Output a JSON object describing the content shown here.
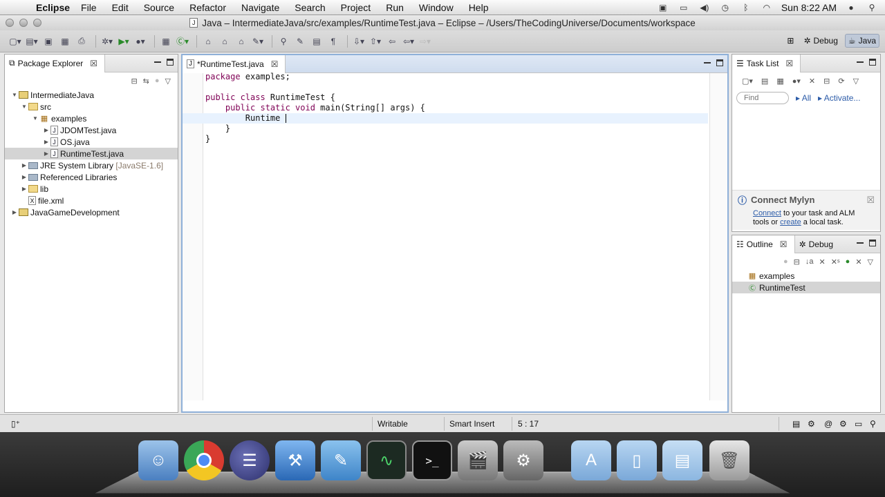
{
  "menubar": {
    "app": "Eclipse",
    "items": [
      "File",
      "Edit",
      "Source",
      "Refactor",
      "Navigate",
      "Search",
      "Project",
      "Run",
      "Window",
      "Help"
    ],
    "clock": "Sun 8:22 AM"
  },
  "window": {
    "title": "Java – IntermediateJava/src/examples/RuntimeTest.java – Eclipse – /Users/TheCodingUniverse/Documents/workspace"
  },
  "perspectives": {
    "debug": "Debug",
    "java": "Java"
  },
  "package_explorer": {
    "tab": "Package Explorer",
    "tree": [
      {
        "label": "IntermediateJava",
        "extra": ""
      },
      {
        "label": "src",
        "extra": ""
      },
      {
        "label": "examples",
        "extra": ""
      },
      {
        "label": "JDOMTest.java",
        "extra": ""
      },
      {
        "label": "OS.java",
        "extra": ""
      },
      {
        "label": "RuntimeTest.java",
        "extra": ""
      },
      {
        "label": "JRE System Library",
        "extra": "[JavaSE-1.6]"
      },
      {
        "label": "Referenced Libraries",
        "extra": ""
      },
      {
        "label": "lib",
        "extra": ""
      },
      {
        "label": "file.xml",
        "extra": ""
      },
      {
        "label": "JavaGameDevelopment",
        "extra": ""
      }
    ]
  },
  "editor": {
    "tab": "*RuntimeTest.java",
    "lines": [
      {
        "kw": "package",
        "rest": " examples;"
      },
      {
        "kw": "",
        "rest": ""
      },
      {
        "kw": "public class",
        "rest": " RuntimeTest {"
      },
      {
        "kw": "    public static void",
        "rest": " main(String[] args) {"
      },
      {
        "kw": "",
        "rest": "        Runtime "
      },
      {
        "kw": "",
        "rest": "    }"
      },
      {
        "kw": "",
        "rest": "}"
      }
    ]
  },
  "task_list": {
    "tab": "Task List",
    "find_placeholder": "Find",
    "all": "All",
    "activate": "Activate...",
    "mylyn_title": "Connect Mylyn",
    "mylyn_connect": "Connect",
    "mylyn_text1": " to your task and ALM",
    "mylyn_text2": "tools or ",
    "mylyn_create": "create",
    "mylyn_text3": " a local task."
  },
  "outline": {
    "tab": "Outline",
    "debug_tab": "Debug",
    "items": [
      "examples",
      "RuntimeTest"
    ]
  },
  "status": {
    "writable": "Writable",
    "insert": "Smart Insert",
    "position": "5 : 17"
  }
}
